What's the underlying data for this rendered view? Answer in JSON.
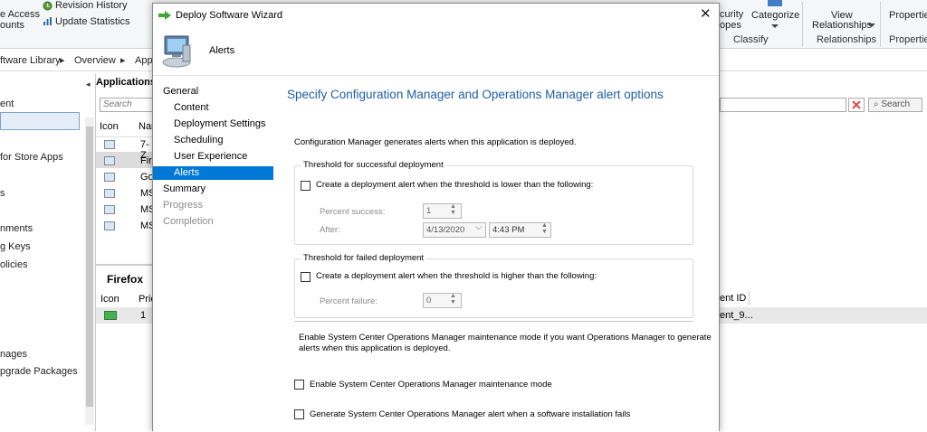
{
  "ribbon": {
    "item_access": "e Access",
    "item_accounts": "ounts",
    "revision_history": "Revision History",
    "update_statistics": "Update Statistics",
    "security_scopes_1": "curity",
    "security_scopes_2": "opes",
    "categorize": "Categorize",
    "view_relationships_1": "View",
    "view_relationships_2": "Relationships",
    "properties": "Properties",
    "groups": {
      "classify": "Classify",
      "relationships": "Relationships",
      "properties": "Properties"
    }
  },
  "breadcrumb": [
    "ftware Library",
    "Overview",
    "App"
  ],
  "leftnav": {
    "items": [
      "ent",
      "for Store Apps",
      "s",
      "nments",
      "g Keys",
      "olicies",
      "nages",
      "pgrade Packages"
    ]
  },
  "apps_pane": {
    "title": "Applications",
    "search_placeholder": "Search",
    "col_icon": "Icon",
    "col_name": "Nan",
    "rows": [
      "7-Z",
      "Fire",
      "Go",
      "MS",
      "MS",
      "MS"
    ],
    "detail_title": "Firefox",
    "detail_col_icon": "Icon",
    "detail_col_priority": "Prio",
    "detail_row_value": "1"
  },
  "right_pane": {
    "search_button": "Search",
    "col_deployment_id": "ent ID",
    "row_deployment_id": "ent_9..."
  },
  "wizard": {
    "title": "Deploy Software Wizard",
    "header_page": "Alerts",
    "steps": [
      {
        "label": "General",
        "indent": false,
        "state": "done"
      },
      {
        "label": "Content",
        "indent": true,
        "state": "done"
      },
      {
        "label": "Deployment Settings",
        "indent": true,
        "state": "done"
      },
      {
        "label": "Scheduling",
        "indent": true,
        "state": "done"
      },
      {
        "label": "User Experience",
        "indent": true,
        "state": "done"
      },
      {
        "label": "Alerts",
        "indent": true,
        "state": "active"
      },
      {
        "label": "Summary",
        "indent": false,
        "state": "done"
      },
      {
        "label": "Progress",
        "indent": false,
        "state": "pending"
      },
      {
        "label": "Completion",
        "indent": false,
        "state": "pending"
      }
    ],
    "heading": "Specify Configuration Manager and Operations Manager alert options",
    "intro": "Configuration Manager generates alerts when this application is deployed.",
    "success_group": {
      "legend": "Threshold for successful deployment",
      "checkbox_label": "Create a deployment alert when the threshold is lower than the following:",
      "checked": false,
      "percent_label": "Percent success:",
      "percent_value": "1",
      "after_label": "After:",
      "date_value": "4/13/2020",
      "time_value": "4:43 PM"
    },
    "failed_group": {
      "legend": "Threshold for failed deployment",
      "checkbox_label": "Create a deployment alert when the threshold is higher than the following:",
      "checked": false,
      "percent_label": "Percent failure:",
      "percent_value": "0"
    },
    "scom_note_1": "Enable System Center Operations Manager maintenance mode if you want Operations Manager to generate",
    "scom_note_2": "alerts when this application is deployed.",
    "maintenance_checkbox": "Enable System Center Operations Manager maintenance mode",
    "maintenance_checked": false,
    "scom_alert_checkbox": "Generate System Center Operations Manager alert when a software installation fails",
    "scom_alert_checked": false
  },
  "colors": {
    "accent": "#0078d7",
    "heading": "#1e5fa8",
    "pending_step": "#8a8a8a",
    "search_clear": "#d9534f"
  }
}
